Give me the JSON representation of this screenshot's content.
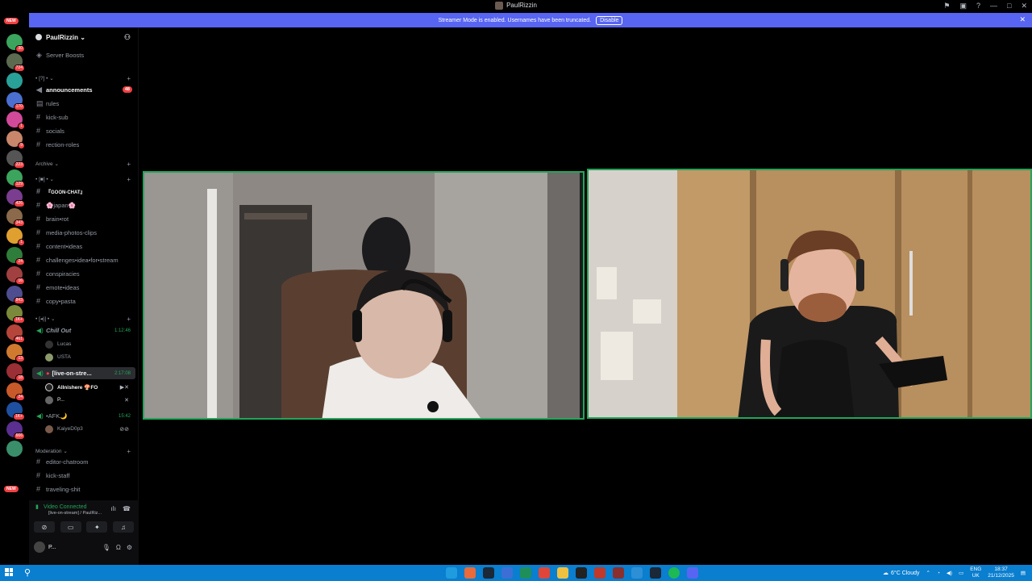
{
  "window": {
    "title": "PaulRizzin"
  },
  "banner": {
    "text": "Streamer Mode is enabled. Usernames have been truncated.",
    "disable_label": "Disable"
  },
  "guilds": {
    "new_top": "NEW",
    "new_bottom": "NEW",
    "badges": [
      "30",
      "724",
      "170",
      "1",
      "9",
      "223",
      "129",
      "426",
      "343",
      "1",
      "24",
      "16",
      "843",
      "1K+",
      "461",
      "13",
      "18",
      "24",
      "1K+",
      "666"
    ]
  },
  "server": {
    "name": "PaulRizzin",
    "boosts_label": "Server Boosts",
    "categories": {
      "first": "• [?] • ⌄",
      "archive": "Archive ⌄",
      "second": "• [■] • ⌄",
      "voice": "• [◂)] • ⌄",
      "moderation": "Moderation ⌄"
    },
    "channels": {
      "announcements": "announcements",
      "announcements_count": "48",
      "rules": "rules",
      "kick_sub": "kick-sub",
      "socials": "socials",
      "reaction_roles": "rection-roles",
      "goon_chat": "『GOON-CHAT』",
      "japan": "🌸japan🌸",
      "brain_rot": "brain•rot",
      "media": "media-photos-clips",
      "content_ideas": "content•ideas",
      "challenges": "challenges•idea•for•stream",
      "conspiracies": "conspiracies",
      "emote_ideas": "emote•ideas",
      "copypasta": "copy•pasta",
      "editor_chatroom": "editor-chatroom",
      "kick_staff": "kick-staff",
      "traveling": "traveling-shit"
    },
    "voice_channels": {
      "chill_out": "Chill Out",
      "chill_out_time": "1:12:46",
      "chill_users": [
        "Lucas",
        "USTA"
      ],
      "live_on_stream": "[live-on-stre...",
      "live_time": "2:17:08",
      "live_users": [
        "Allnishere 🍄FO",
        "P..."
      ],
      "afk": "•AFK🌙",
      "afk_time": "15:42",
      "afk_users": [
        "KaiyeD0p3"
      ]
    }
  },
  "voice_panel": {
    "status": "Video Connected",
    "sub": "[live-on-stream] / PaulRiz...",
    "username": "P..."
  },
  "taskbar": {
    "weather": "6°C Cloudy",
    "lang_top": "ENG",
    "lang_bottom": "UK",
    "time": "18:37",
    "date": "21/12/2025"
  }
}
